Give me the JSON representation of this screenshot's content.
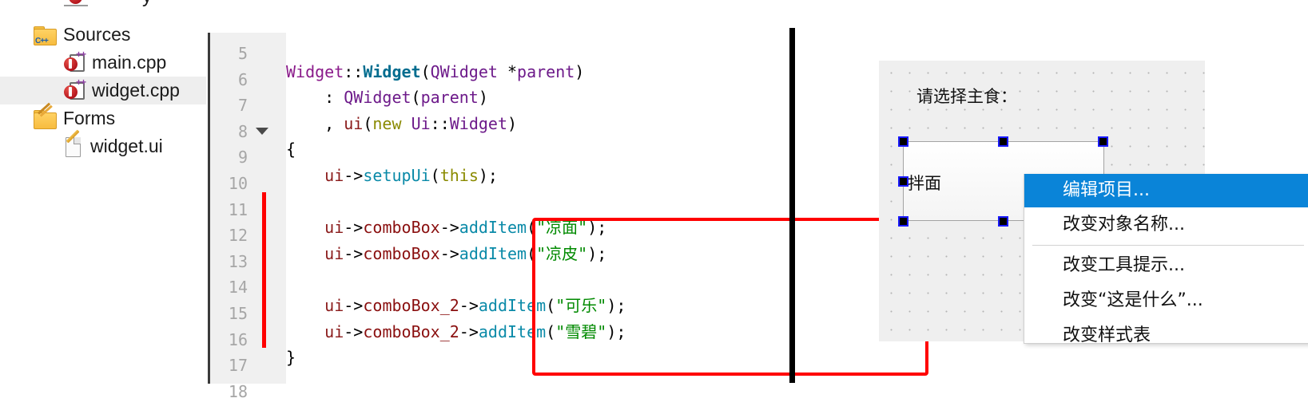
{
  "project_tree": {
    "items": [
      {
        "label": "Sources",
        "icon": "folder-cpp-icon",
        "indent": 1,
        "selected": false
      },
      {
        "label": "main.cpp",
        "icon": "cpp-file-icon",
        "indent": 2,
        "selected": false
      },
      {
        "label": "widget.cpp",
        "icon": "cpp-file-icon",
        "indent": 2,
        "selected": true
      },
      {
        "label": "Forms",
        "icon": "folder-forms-icon",
        "indent": 1,
        "selected": false
      },
      {
        "label": "widget.ui",
        "icon": "ui-file-icon",
        "indent": 2,
        "selected": false
      }
    ]
  },
  "editor": {
    "line_numbers": [
      "5",
      "6",
      "7",
      "8",
      "9",
      "10",
      "11",
      "12",
      "13",
      "14",
      "15",
      "16",
      "17",
      "18"
    ],
    "fold_marker_line": "8",
    "change_bar_from_line": "11",
    "change_bar_to_line": "16",
    "lines": [
      {
        "n": "5",
        "tokens": []
      },
      {
        "n": "6",
        "tokens": [
          {
            "t": "Widget",
            "c": "tk-class"
          },
          {
            "t": "::",
            "c": "tk-punct"
          },
          {
            "t": "Widget",
            "c": "tk-classb"
          },
          {
            "t": "(",
            "c": "tk-punct"
          },
          {
            "t": "QWidget",
            "c": "tk-type"
          },
          {
            "t": " *",
            "c": "tk-punct"
          },
          {
            "t": "parent",
            "c": "tk-type"
          },
          {
            "t": ")",
            "c": "tk-punct"
          }
        ]
      },
      {
        "n": "7",
        "tokens": [
          {
            "t": "    : ",
            "c": "tk-punct"
          },
          {
            "t": "QWidget",
            "c": "tk-type"
          },
          {
            "t": "(",
            "c": "tk-punct"
          },
          {
            "t": "parent",
            "c": "tk-type"
          },
          {
            "t": ")",
            "c": "tk-punct"
          }
        ]
      },
      {
        "n": "8",
        "tokens": [
          {
            "t": "    , ",
            "c": "tk-punct"
          },
          {
            "t": "ui",
            "c": "tk-var"
          },
          {
            "t": "(",
            "c": "tk-punct"
          },
          {
            "t": "new",
            "c": "tk-kw"
          },
          {
            "t": " ",
            "c": "tk-punct"
          },
          {
            "t": "Ui",
            "c": "tk-type"
          },
          {
            "t": "::",
            "c": "tk-punct"
          },
          {
            "t": "Widget",
            "c": "tk-type"
          },
          {
            "t": ")",
            "c": "tk-punct"
          }
        ]
      },
      {
        "n": "9",
        "tokens": [
          {
            "t": "{",
            "c": "tk-punct"
          }
        ]
      },
      {
        "n": "10",
        "tokens": [
          {
            "t": "    ",
            "c": "tk-punct"
          },
          {
            "t": "ui",
            "c": "tk-var"
          },
          {
            "t": "->",
            "c": "tk-punct"
          },
          {
            "t": "setupUi",
            "c": "tk-func"
          },
          {
            "t": "(",
            "c": "tk-punct"
          },
          {
            "t": "this",
            "c": "tk-kw"
          },
          {
            "t": ");",
            "c": "tk-punct"
          }
        ]
      },
      {
        "n": "11",
        "tokens": []
      },
      {
        "n": "12",
        "tokens": [
          {
            "t": "    ",
            "c": "tk-punct"
          },
          {
            "t": "ui",
            "c": "tk-var"
          },
          {
            "t": "->",
            "c": "tk-punct"
          },
          {
            "t": "comboBox",
            "c": "tk-field"
          },
          {
            "t": "->",
            "c": "tk-punct"
          },
          {
            "t": "addItem",
            "c": "tk-func"
          },
          {
            "t": "(",
            "c": "tk-punct"
          },
          {
            "t": "\"凉面\"",
            "c": "tk-str"
          },
          {
            "t": ");",
            "c": "tk-punct"
          }
        ]
      },
      {
        "n": "13",
        "tokens": [
          {
            "t": "    ",
            "c": "tk-punct"
          },
          {
            "t": "ui",
            "c": "tk-var"
          },
          {
            "t": "->",
            "c": "tk-punct"
          },
          {
            "t": "comboBox",
            "c": "tk-field"
          },
          {
            "t": "->",
            "c": "tk-punct"
          },
          {
            "t": "addItem",
            "c": "tk-func"
          },
          {
            "t": "(",
            "c": "tk-punct"
          },
          {
            "t": "\"凉皮\"",
            "c": "tk-str"
          },
          {
            "t": ");",
            "c": "tk-punct"
          }
        ]
      },
      {
        "n": "14",
        "tokens": []
      },
      {
        "n": "15",
        "tokens": [
          {
            "t": "    ",
            "c": "tk-punct"
          },
          {
            "t": "ui",
            "c": "tk-var"
          },
          {
            "t": "->",
            "c": "tk-punct"
          },
          {
            "t": "comboBox_2",
            "c": "tk-field"
          },
          {
            "t": "->",
            "c": "tk-punct"
          },
          {
            "t": "addItem",
            "c": "tk-func"
          },
          {
            "t": "(",
            "c": "tk-punct"
          },
          {
            "t": "\"可乐\"",
            "c": "tk-str"
          },
          {
            "t": ");",
            "c": "tk-punct"
          }
        ]
      },
      {
        "n": "16",
        "tokens": [
          {
            "t": "    ",
            "c": "tk-punct"
          },
          {
            "t": "ui",
            "c": "tk-var"
          },
          {
            "t": "->",
            "c": "tk-punct"
          },
          {
            "t": "comboBox_2",
            "c": "tk-field"
          },
          {
            "t": "->",
            "c": "tk-punct"
          },
          {
            "t": "addItem",
            "c": "tk-func"
          },
          {
            "t": "(",
            "c": "tk-punct"
          },
          {
            "t": "\"雪碧\"",
            "c": "tk-str"
          },
          {
            "t": ");",
            "c": "tk-punct"
          }
        ]
      },
      {
        "n": "17",
        "tokens": [
          {
            "t": "}",
            "c": "tk-punct"
          }
        ]
      },
      {
        "n": "18",
        "tokens": []
      }
    ],
    "annotation_color": "#ff0000"
  },
  "designer": {
    "form_label": "请选择主食：",
    "combo_current_text": "拌面",
    "grid_color": "#b4b4b4",
    "selection_handle_color": "#1a1aff"
  },
  "context_menu": {
    "highlight_color": "#0a84d8",
    "items": [
      {
        "label": "编辑项目...",
        "highlighted": true,
        "separator_after": false
      },
      {
        "label": "改变对象名称...",
        "highlighted": false,
        "separator_after": true
      },
      {
        "label": "改变工具提示...",
        "highlighted": false,
        "separator_after": false
      },
      {
        "label": "改变“这是什么”...",
        "highlighted": false,
        "separator_after": false
      },
      {
        "label": "改变样式表",
        "highlighted": false,
        "separator_after": false
      }
    ]
  }
}
